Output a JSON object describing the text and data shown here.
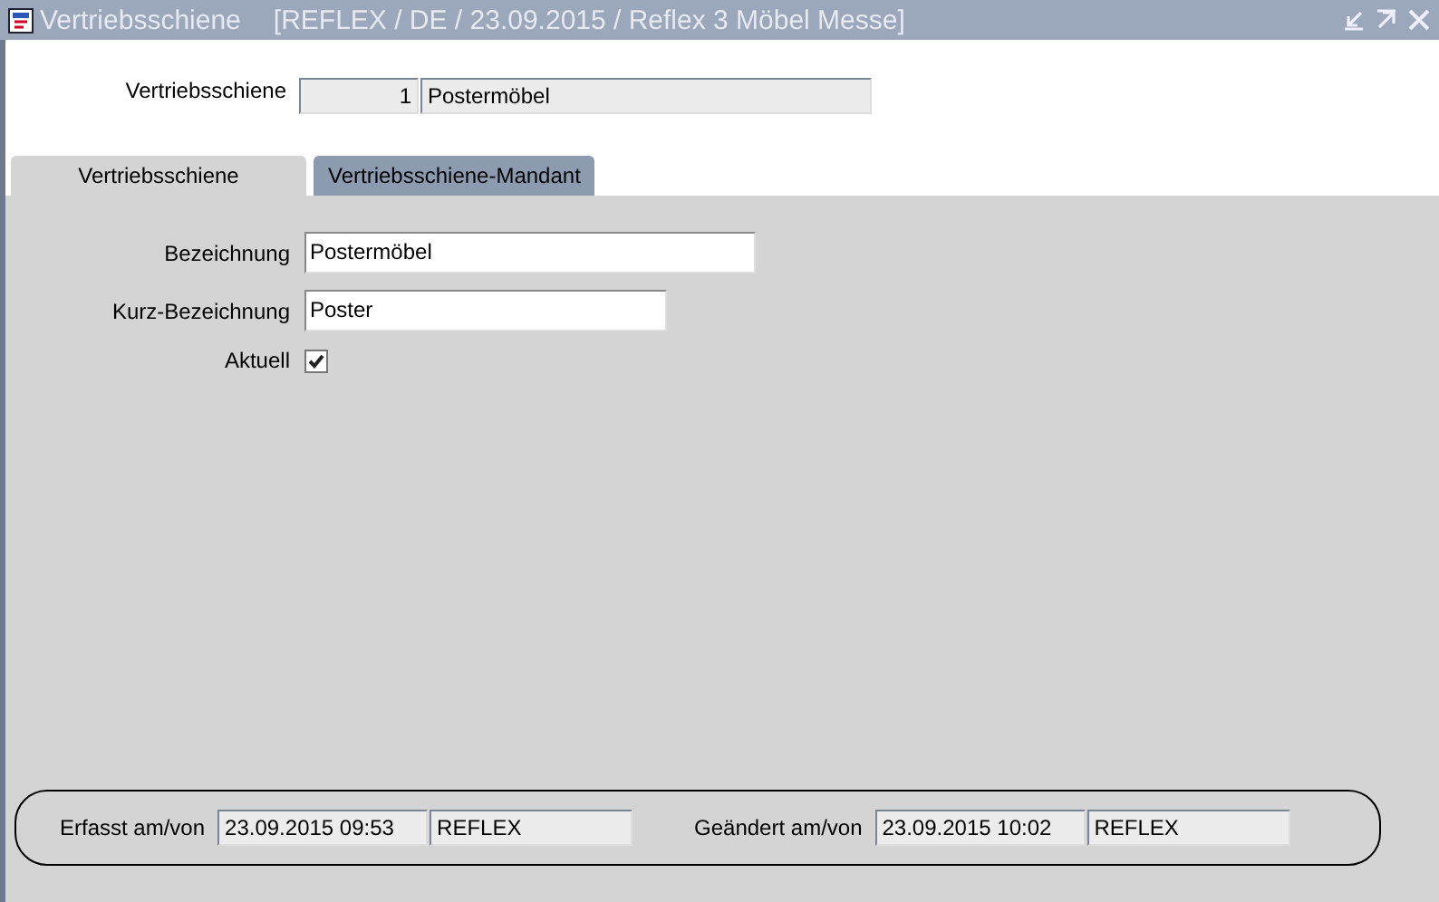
{
  "window": {
    "title": "Vertriebsschiene",
    "context": "[REFLEX / DE / 23.09.2015 / Reflex 3 Möbel Messe]"
  },
  "header": {
    "label": "Vertriebsschiene",
    "number": "1",
    "name": "Postermöbel"
  },
  "tabs": [
    {
      "label": "Vertriebsschiene",
      "selected": true
    },
    {
      "label": "Vertriebsschiene-Mandant",
      "selected": false
    }
  ],
  "form": [
    {
      "kind": "text",
      "label": "Bezeichnung",
      "value": "Postermöbel"
    },
    {
      "kind": "text",
      "label": "Kurz-Bezeichnung",
      "value": "Poster"
    },
    {
      "kind": "checkbox",
      "label": "Aktuell",
      "checked": true
    }
  ],
  "audit": [
    {
      "label": "Erfasst am/von",
      "timestamp": "23.09.2015 09:53",
      "user": "REFLEX"
    },
    {
      "label": "Geändert am/von",
      "timestamp": "23.09.2015 10:02",
      "user": "REFLEX"
    }
  ]
}
